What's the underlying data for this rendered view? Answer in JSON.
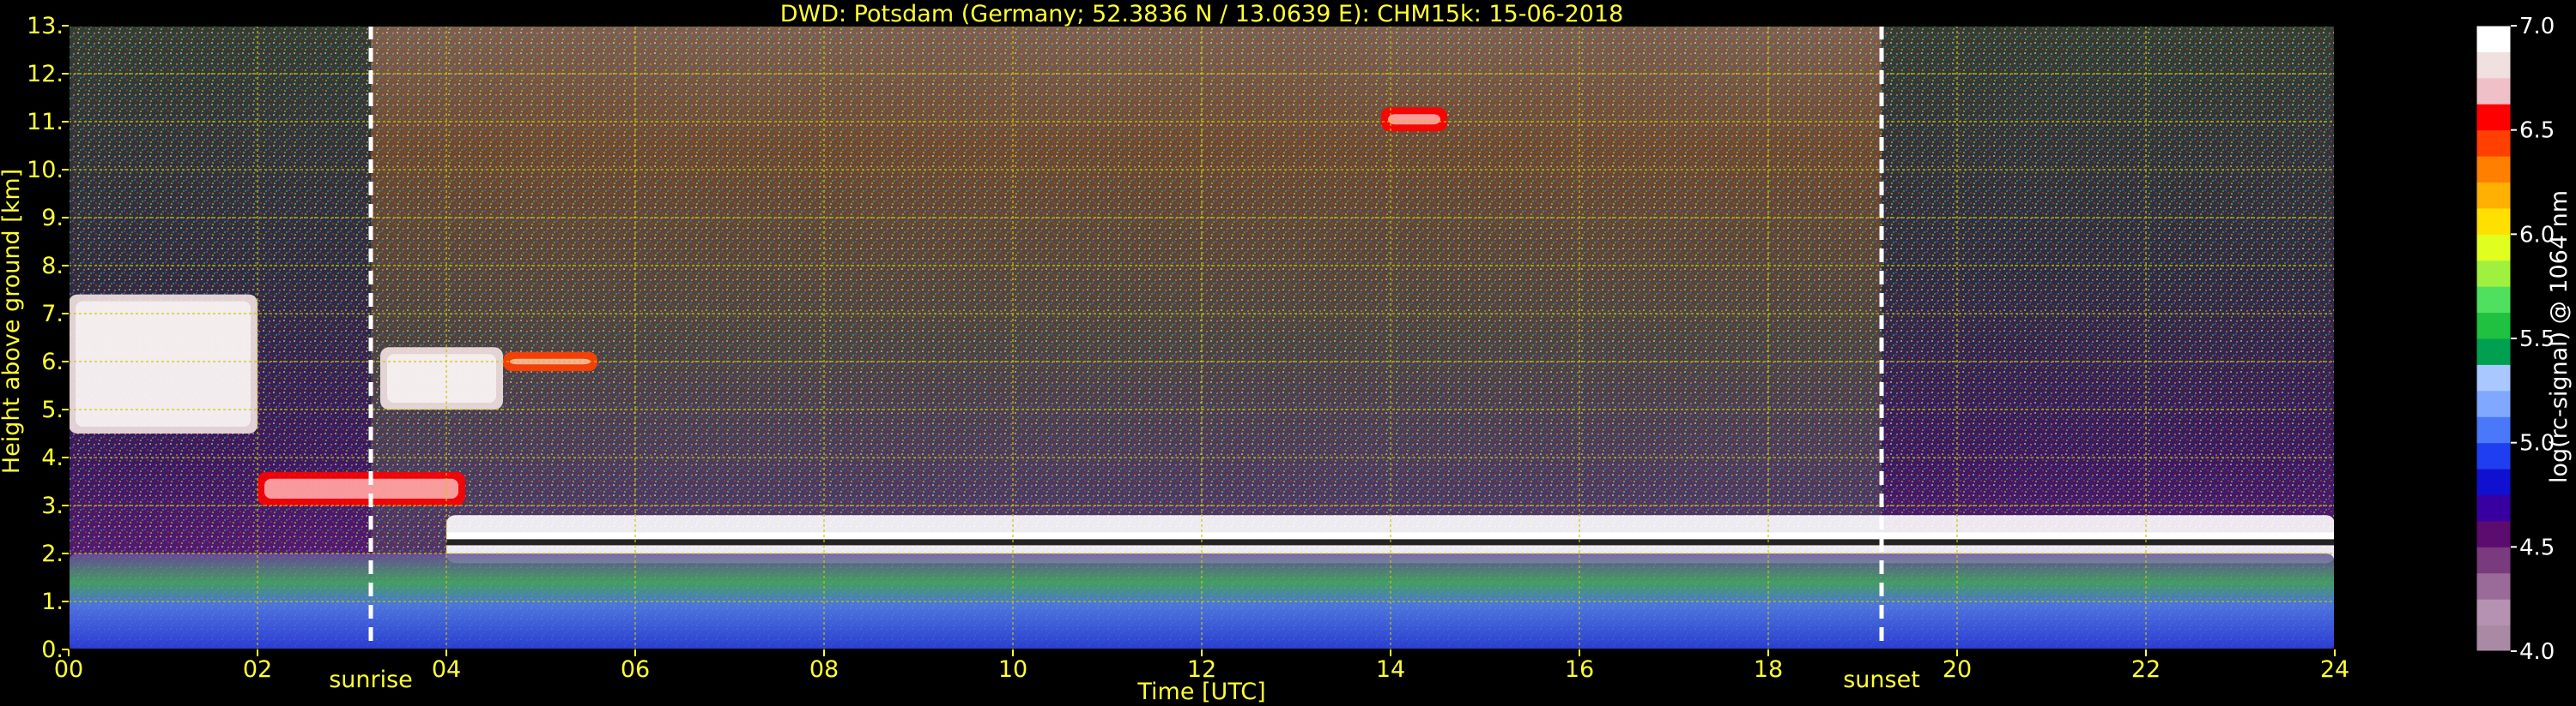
{
  "chart_data": {
    "type": "heatmap",
    "title": "DWD: Potsdam (Germany; 52.3836 N / 13.0639 E):    CHM15k: 15-06-2018",
    "xlabel": "Time [UTC]",
    "ylabel": "Height above ground [km]",
    "xlim": [
      0,
      24
    ],
    "ylim": [
      0,
      13
    ],
    "x_ticks": [
      "00",
      "02",
      "04",
      "06",
      "08",
      "10",
      "12",
      "14",
      "16",
      "18",
      "20",
      "22",
      "24"
    ],
    "y_ticks": [
      "0.",
      "1.",
      "2.",
      "3.",
      "4.",
      "5.",
      "6.",
      "7.",
      "8.",
      "9.",
      "10.",
      "11.",
      "12.",
      "13."
    ],
    "grid": true,
    "colorbar": {
      "label": "log(rc-signal) @ 1064 nm",
      "range": [
        4.0,
        7.0
      ],
      "ticks": [
        "4.0",
        "4.5",
        "5.0",
        "5.5",
        "6.0",
        "6.5",
        "7.0"
      ],
      "colors": [
        "#a98aa4",
        "#b692b2",
        "#9a6a98",
        "#7a3a7e",
        "#5c0c6e",
        "#3800a0",
        "#1010d0",
        "#1e3ef0",
        "#4a78f8",
        "#80a8ff",
        "#a8c8ff",
        "#00a050",
        "#20c040",
        "#50e060",
        "#a0f040",
        "#e0ff20",
        "#ffe000",
        "#ffb000",
        "#ff8000",
        "#ff4000",
        "#ff0000",
        "#f0c0c8",
        "#f0e0e0",
        "#ffffff"
      ]
    },
    "annotations": [
      {
        "text": "sunrise",
        "x": 3.2
      },
      {
        "text": "sunset",
        "x": 19.2
      }
    ],
    "layers": [
      {
        "name": "cloud",
        "x": [
          0,
          2
        ],
        "y": [
          4.5,
          7.4
        ],
        "intensity": 6.8
      },
      {
        "name": "cloud",
        "x": [
          3.3,
          4.6
        ],
        "y": [
          5.0,
          6.3
        ],
        "intensity": 6.8
      },
      {
        "name": "cloud",
        "x": [
          4.6,
          5.6
        ],
        "y": [
          5.8,
          6.2
        ],
        "intensity": 6.4
      },
      {
        "name": "cloud",
        "x": [
          13.9,
          14.6
        ],
        "y": [
          10.8,
          11.3
        ],
        "intensity": 6.6
      },
      {
        "name": "cloud_base",
        "x": [
          4.0,
          24.0
        ],
        "y": [
          1.8,
          2.8
        ],
        "intensity": 6.9
      },
      {
        "name": "boundary_layer",
        "x": [
          0,
          24
        ],
        "y": [
          0,
          2.0
        ],
        "intensity": 5.6
      },
      {
        "name": "cloud_low",
        "x": [
          2.0,
          4.2
        ],
        "y": [
          3.0,
          3.7
        ],
        "intensity": 6.5
      }
    ]
  }
}
